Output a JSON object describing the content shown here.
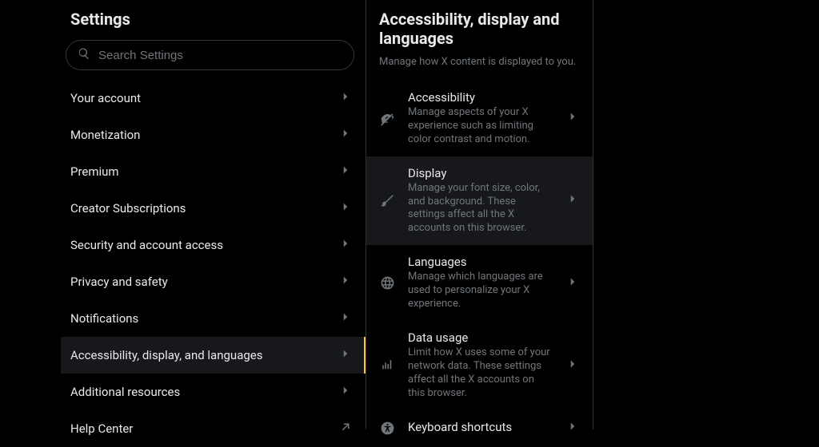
{
  "sidebar": {
    "title": "Settings",
    "search_placeholder": "Search Settings",
    "items": [
      {
        "label": "Your account",
        "active": false,
        "external": false
      },
      {
        "label": "Monetization",
        "active": false,
        "external": false
      },
      {
        "label": "Premium",
        "active": false,
        "external": false
      },
      {
        "label": "Creator Subscriptions",
        "active": false,
        "external": false
      },
      {
        "label": "Security and account access",
        "active": false,
        "external": false
      },
      {
        "label": "Privacy and safety",
        "active": false,
        "external": false
      },
      {
        "label": "Notifications",
        "active": false,
        "external": false
      },
      {
        "label": "Accessibility, display, and languages",
        "active": true,
        "external": false
      },
      {
        "label": "Additional resources",
        "active": false,
        "external": false
      },
      {
        "label": "Help Center",
        "active": false,
        "external": true
      }
    ]
  },
  "main": {
    "title": "Accessibility, display and languages",
    "subtitle": "Manage how X content is displayed to you.",
    "options": [
      {
        "icon": "eye-off-icon",
        "title": "Accessibility",
        "desc": "Manage aspects of your X experience such as limiting color contrast and motion.",
        "highlight": false
      },
      {
        "icon": "brush-icon",
        "title": "Display",
        "desc": "Manage your font size, color, and background. These settings affect all the X accounts on this browser.",
        "highlight": true
      },
      {
        "icon": "globe-icon",
        "title": "Languages",
        "desc": "Manage which languages are used to personalize your X experience.",
        "highlight": false
      },
      {
        "icon": "bars-icon",
        "title": "Data usage",
        "desc": "Limit how X uses some of your network data. These settings affect all the X accounts on this browser.",
        "highlight": false
      },
      {
        "icon": "accessibility-icon",
        "title": "Keyboard shortcuts",
        "desc": "",
        "highlight": false
      }
    ]
  }
}
